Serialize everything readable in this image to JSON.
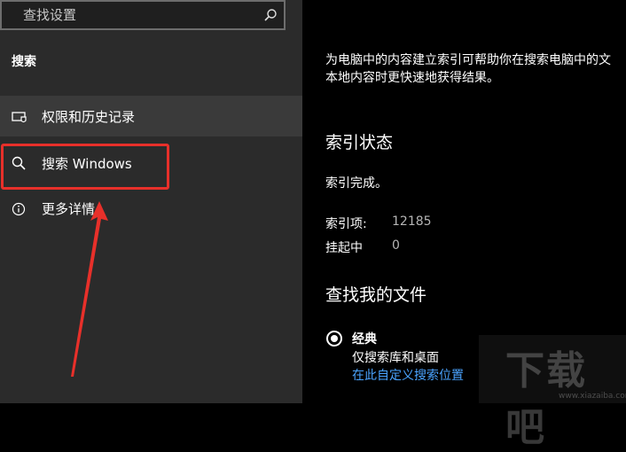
{
  "sidebar": {
    "search_placeholder": "查找设置",
    "section_label": "搜索",
    "items": [
      {
        "label": "权限和历史记录",
        "icon": "permissions-icon"
      },
      {
        "label": "搜索 Windows",
        "icon": "search-icon"
      },
      {
        "label": "更多详情",
        "icon": "info-icon"
      }
    ]
  },
  "content": {
    "description": [
      "为电脑中的内容建立索引可帮助你在搜索电脑中的文",
      "本地内容时更快速地获得结果。"
    ],
    "index_status_heading": "索引状态",
    "index_status_text": "索引完成。",
    "stats": [
      {
        "label": "索引项:",
        "value": "12185"
      },
      {
        "label": "挂起中",
        "value": "0"
      }
    ],
    "find_files_heading": "查找我的文件",
    "option": {
      "title": "经典",
      "description": "仅搜索库和桌面",
      "link": "在此自定义搜索位置"
    }
  },
  "watermark": {
    "text": "下载吧",
    "sub": "www.xiazaiba.com"
  },
  "colors": {
    "sidebar_bg": "#2b2b2b",
    "content_bg": "#000000",
    "highlight": "#e8302a",
    "link": "#4aa3ff"
  }
}
